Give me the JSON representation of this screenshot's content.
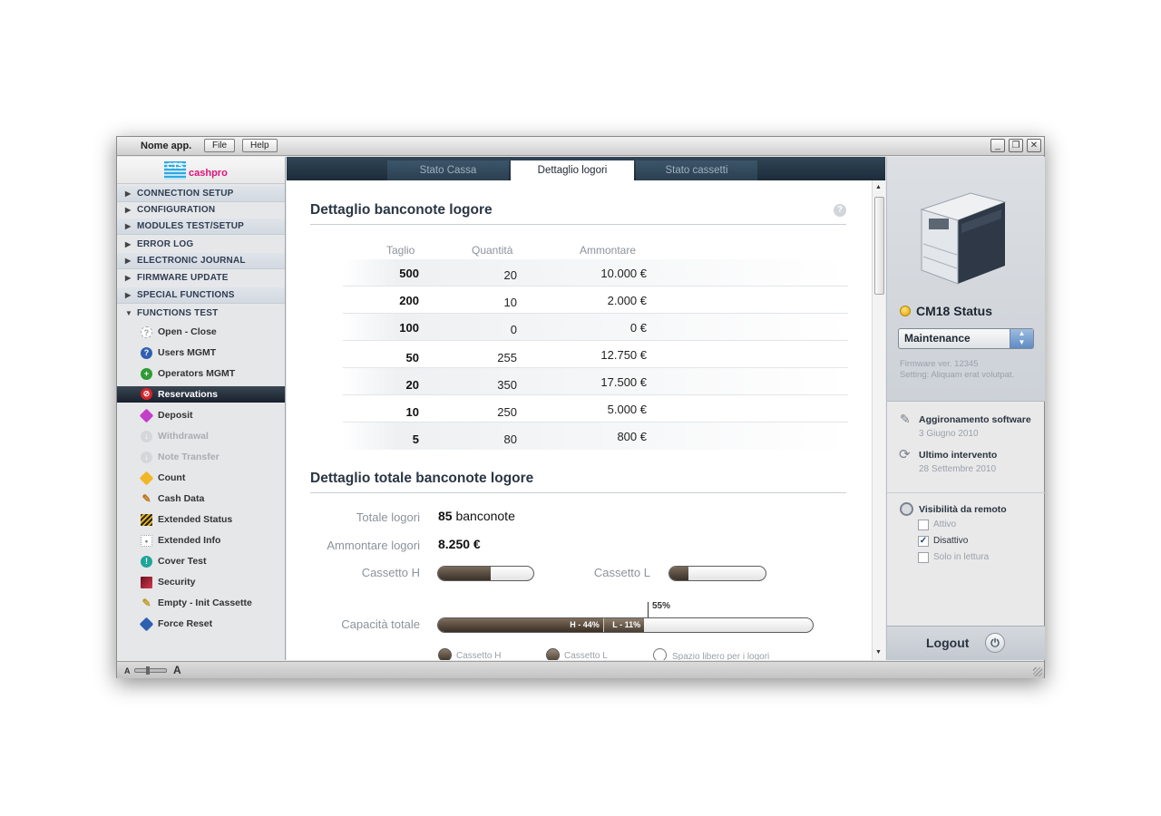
{
  "titlebar": {
    "app_name": "Nome app.",
    "menu": [
      "File",
      "Help"
    ]
  },
  "logo": {
    "mark": "CTS",
    "brand": "cashpro"
  },
  "sidebar": {
    "sections": [
      "CONNECTION SETUP",
      "CONFIGURATION",
      "MODULES TEST/SETUP",
      "ERROR LOG",
      "ELECTRONIC JOURNAL",
      "FIRMWARE UPDATE",
      "SPECIAL FUNCTIONS",
      "FUNCTIONS TEST"
    ],
    "function_items": [
      {
        "label": "Open - Close",
        "icon": "question-icon",
        "state": "normal"
      },
      {
        "label": "Users MGMT",
        "icon": "info-blue-icon",
        "state": "normal"
      },
      {
        "label": "Operators MGMT",
        "icon": "plus-green-icon",
        "state": "normal"
      },
      {
        "label": "Reservations",
        "icon": "no-entry-icon",
        "state": "selected"
      },
      {
        "label": "Deposit",
        "icon": "deposit-diamond-icon",
        "state": "normal"
      },
      {
        "label": "Withdrawal",
        "icon": "withdrawal-icon",
        "state": "disabled"
      },
      {
        "label": "Note Transfer",
        "icon": "transfer-icon",
        "state": "disabled"
      },
      {
        "label": "Count",
        "icon": "count-diamond-icon",
        "state": "normal"
      },
      {
        "label": "Cash Data",
        "icon": "pencil-icon",
        "state": "normal"
      },
      {
        "label": "Extended Status",
        "icon": "status-stripes-icon",
        "state": "normal"
      },
      {
        "label": "Extended Info",
        "icon": "dotted-square-icon",
        "state": "normal"
      },
      {
        "label": "Cover Test",
        "icon": "cover-teal-icon",
        "state": "normal"
      },
      {
        "label": "Security",
        "icon": "security-book-icon",
        "state": "normal"
      },
      {
        "label": "Empty - Init Cassette",
        "icon": "empty-pencil-icon",
        "state": "normal"
      },
      {
        "label": "Force Reset",
        "icon": "reset-diamond-icon",
        "state": "normal"
      }
    ]
  },
  "tabs": [
    {
      "label": "Stato Cassa",
      "active": false
    },
    {
      "label": "Dettaglio logori",
      "active": true
    },
    {
      "label": "Stato cassetti",
      "active": false
    }
  ],
  "section1": {
    "title": "Dettaglio banconote logore",
    "headers": [
      "Taglio",
      "Quantità",
      "Ammontare"
    ],
    "rows": [
      [
        "500",
        "20",
        "10.000 €"
      ],
      [
        "200",
        "10",
        "2.000 €"
      ],
      [
        "100",
        "0",
        "0 €"
      ],
      [
        "50",
        "255",
        "12.750 €"
      ],
      [
        "20",
        "350",
        "17.500 €"
      ],
      [
        "10",
        "250",
        "5.000 €"
      ],
      [
        "5",
        "80",
        "800 €"
      ]
    ]
  },
  "section2": {
    "title": "Dettaglio totale banconote logore",
    "totale_label": "Totale logori",
    "totale_value": "85",
    "totale_unit": "banconote",
    "ammontare_label": "Ammontare logori",
    "ammontare_value": "8.250 €",
    "cassetto_h_label": "Cassetto H",
    "cassetto_h_fill": 0.55,
    "cassetto_l_label": "Cassetto L",
    "cassetto_l_fill": 0.2,
    "capacita_label": "Capacità totale",
    "capacita_marker": "55%",
    "segment_h": "H - 44%",
    "segment_h_value": 44,
    "segment_l": "L - 11%",
    "segment_l_value": 11,
    "legend": [
      "Cassetto H",
      "Cassetto L",
      "Spazio libero per i logori"
    ]
  },
  "right_panel": {
    "status_title": "CM18 Status",
    "status_color": "#f2b800",
    "mode": "Maintenance",
    "firmware": "Firmware ver. 12345",
    "setting": "Setting: Aliquam erat volutpat.",
    "update_title": "Aggironamento software",
    "update_date": "3 Giugno 2010",
    "intervento_title": "Ultimo intervento",
    "intervento_date": "28 Settembre 2010",
    "visibility_title": "Visibilità da remoto",
    "options": [
      {
        "label": "Attivo",
        "checked": false
      },
      {
        "label": "Disattivo",
        "checked": true
      },
      {
        "label": "Solo in lettura",
        "checked": false
      }
    ],
    "logout": "Logout"
  },
  "statusbar": {
    "small_a": "A",
    "large_a": "A"
  }
}
